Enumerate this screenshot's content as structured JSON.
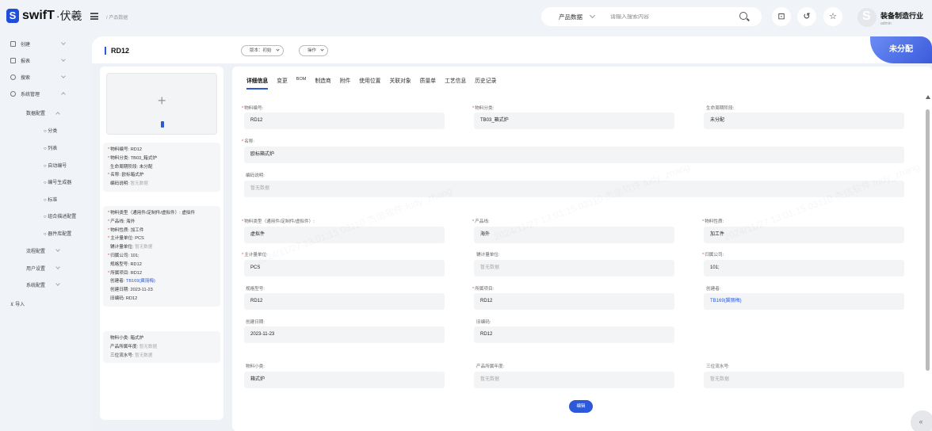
{
  "brand": {
    "name": "swifT",
    "suffix": "伏羲"
  },
  "breadcrumb": "产品数据",
  "search": {
    "scope": "产品数据",
    "placeholder": "请输入搜索内容"
  },
  "toolbar": {
    "scan_icon": "scan-icon",
    "history_icon": "history-icon",
    "star_icon": "star-settings-icon"
  },
  "user": {
    "company": "装备制造行业",
    "account": "admin"
  },
  "sidebar": {
    "items": [
      {
        "label": "创建",
        "icon": "create-icon"
      },
      {
        "label": "报表",
        "icon": "report-icon"
      },
      {
        "label": "搜索",
        "icon": "search-icon"
      },
      {
        "label": "系统管理",
        "icon": "settings-icon"
      }
    ],
    "data_config": "数据配置",
    "data_config_children": [
      "分类",
      "列表",
      "自动编号",
      "编号生成器",
      "标准",
      "组合描述配置",
      "器件库配置"
    ],
    "flow_config": "流程配置",
    "user_settings": "用户设置",
    "system_config": "系统配置",
    "import": "导入"
  },
  "header": {
    "title": "RD12",
    "version": "版本：初始",
    "actions": "操作",
    "status": "未分配"
  },
  "summary": {
    "block1": [
      {
        "req": true,
        "label": "物料编号:",
        "value": "RD12"
      },
      {
        "req": true,
        "label": "物料分类:",
        "value": "TB03_箱式炉"
      },
      {
        "req": false,
        "label": "生命周期阶段:",
        "value": "未分配"
      },
      {
        "req": true,
        "label": "名称:",
        "value": "欧标箱式炉"
      },
      {
        "req": false,
        "label": "编码说明:",
        "value": "暂无数据",
        "muted": true
      }
    ],
    "block2": [
      {
        "req": true,
        "label": "物料类型（通用件/定制件/虚拟件）:",
        "value": "虚拟件"
      },
      {
        "req": true,
        "label": "产品线:",
        "value": "海外"
      },
      {
        "req": true,
        "label": "物料性质:",
        "value": "加工件"
      },
      {
        "req": true,
        "label": "主计量单位:",
        "value": "PCS"
      },
      {
        "req": false,
        "label": "辅计量单位:",
        "value": "暂无数据",
        "muted": true
      },
      {
        "req": true,
        "label": "归属公司:",
        "value": "101;"
      },
      {
        "req": false,
        "label": "规格型号:",
        "value": "RD12"
      },
      {
        "req": true,
        "label": "所属项目:",
        "value": "RD12"
      },
      {
        "req": false,
        "label": "创建者:",
        "value": "TB169(冀丽梅)",
        "link": true
      },
      {
        "req": false,
        "label": "创建日期:",
        "value": "2023-11-23"
      },
      {
        "req": false,
        "label": "旧编码:",
        "value": "RD12"
      }
    ],
    "block3": [
      {
        "req": false,
        "label": "物料小类:",
        "value": "箱式炉"
      },
      {
        "req": false,
        "label": "产品所属年度:",
        "value": "暂无数据",
        "muted": true
      },
      {
        "req": false,
        "label": "三位流水号:",
        "value": "暂无数据",
        "muted": true
      }
    ]
  },
  "tabs": [
    "详细信息",
    "变更",
    "BOM",
    "制造商",
    "附件",
    "使用位置",
    "关联对象",
    "质量单",
    "工艺信息",
    "历史记录"
  ],
  "fields": {
    "material_no": {
      "label": "物料编号:",
      "value": "RD12"
    },
    "material_class": {
      "label": "物料分类:",
      "value": "TB03_箱式炉"
    },
    "lifecycle": {
      "label": "生命周期阶段:",
      "value": "未分配"
    },
    "name": {
      "label": "名称:",
      "value": "欧标箱式炉"
    },
    "code_desc": {
      "label": "编码说明:",
      "value": "暂无数据"
    },
    "material_type": {
      "label": "物料类型（通用件/定制件/虚拟件）:",
      "value": "虚拟件"
    },
    "product_line": {
      "label": "产品线:",
      "value": "海外"
    },
    "material_nature": {
      "label": "物料性质:",
      "value": "加工件"
    },
    "main_unit": {
      "label": "主计量单位:",
      "value": "PCS"
    },
    "aux_unit": {
      "label": "辅计量单位:",
      "value": "暂无数据"
    },
    "company": {
      "label": "归属公司:",
      "value": "101;"
    },
    "spec": {
      "label": "规格型号:",
      "value": "RD12"
    },
    "project": {
      "label": "所属项目:",
      "value": "RD12"
    },
    "creator": {
      "label": "创建者:",
      "value": "TB169(冀丽梅)"
    },
    "created": {
      "label": "创建日期:",
      "value": "2023-11-23"
    },
    "old_code": {
      "label": "旧编码:",
      "value": "RD12"
    },
    "subclass": {
      "label": "物料小类:",
      "value": "箱式炉"
    },
    "product_year": {
      "label": "产品所属年度:",
      "value": "暂无数据"
    },
    "serial": {
      "label": "三位流水号:",
      "value": "暂无数据"
    }
  },
  "edit_button": "编辑",
  "collapse": "«",
  "watermark": "2024/11/27 13:01:15 03110 杰信软件 fudy_zhang",
  "colors": {
    "accent": "#2b59d9",
    "required": "#e74c3c"
  }
}
